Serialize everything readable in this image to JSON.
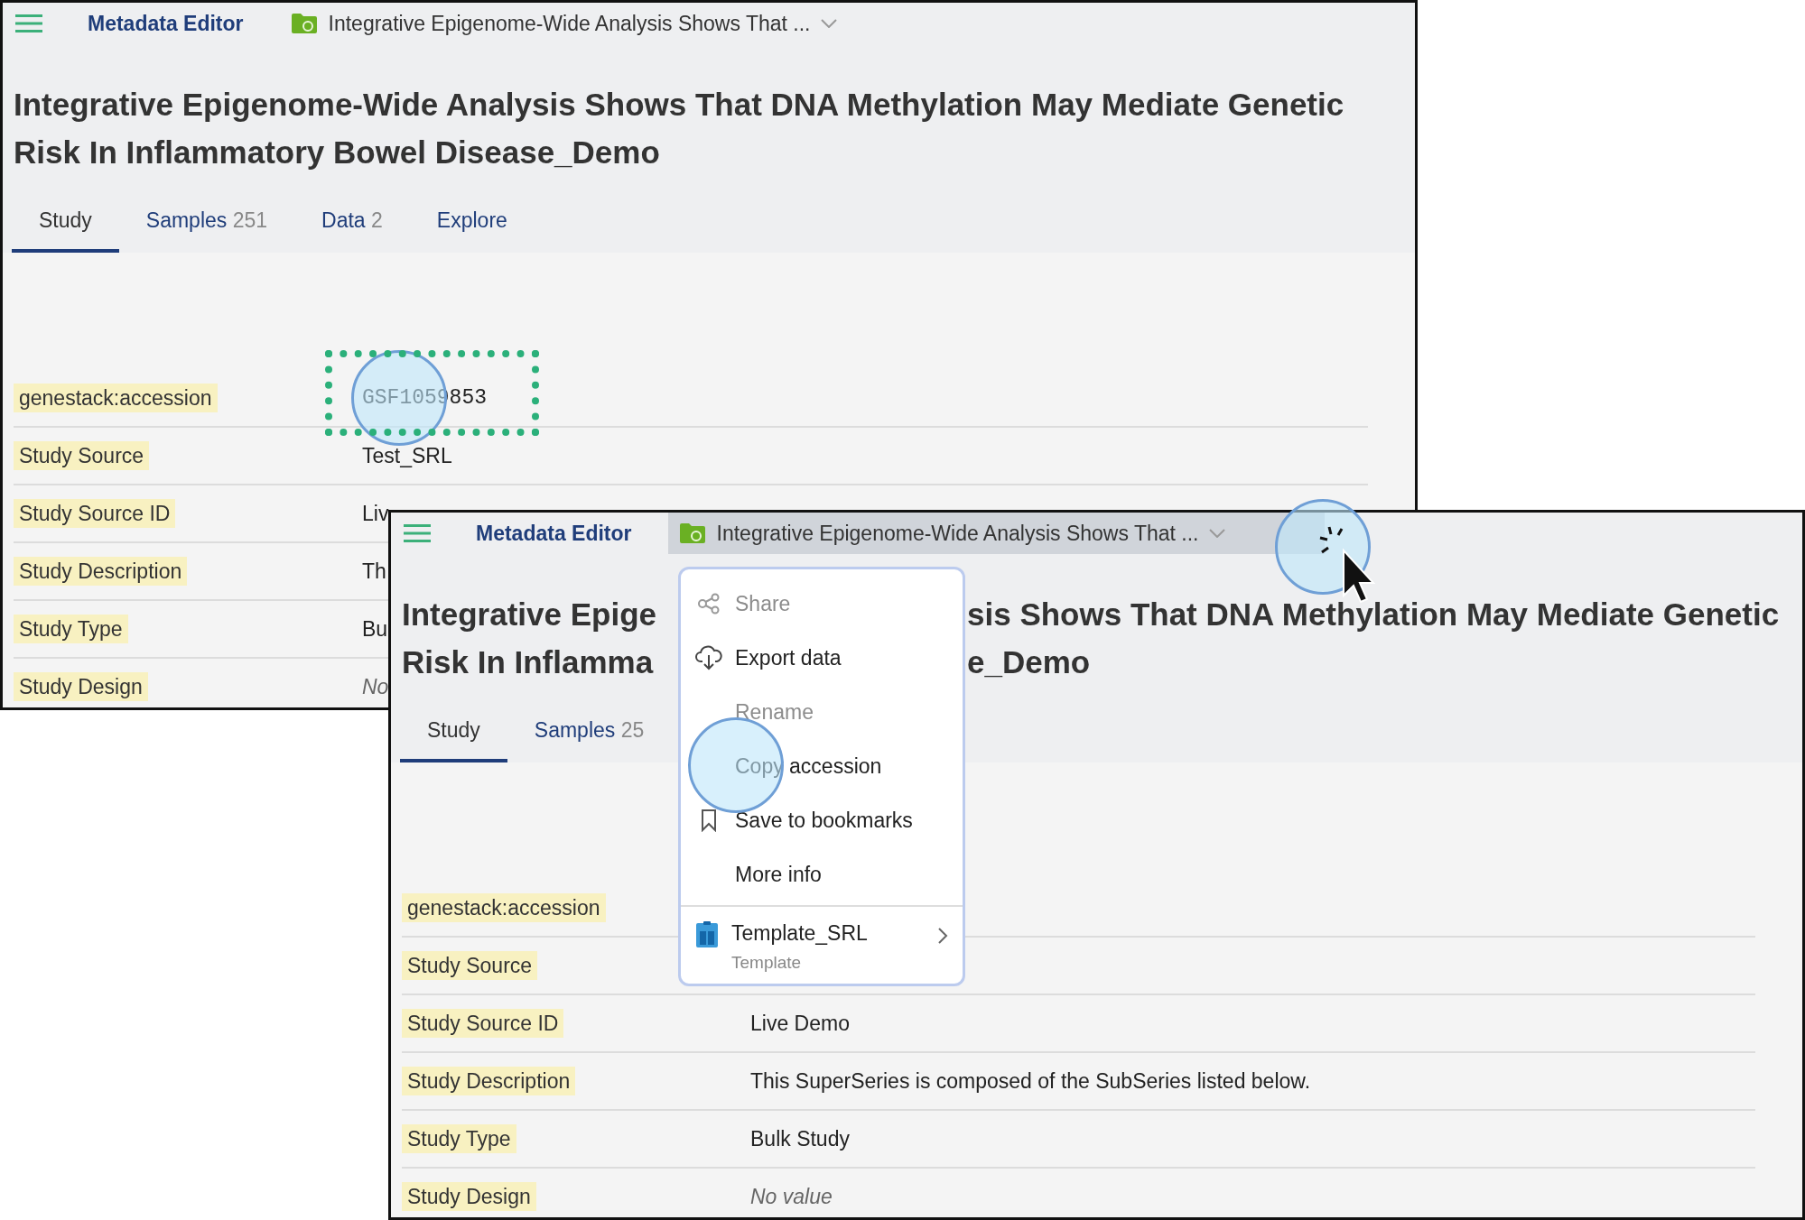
{
  "windows": [
    {
      "header": {
        "app_title": "Metadata Editor",
        "dataset_title": "Integrative Epigenome-Wide Analysis Shows That ...",
        "dropdown_open": false
      },
      "title": "Integrative Epigenome-Wide Analysis Shows That DNA Methylation May Mediate Genetic Risk In Inflammatory Bowel Disease_Demo",
      "tabs": [
        {
          "label": "Study",
          "selected": true
        },
        {
          "label": "Samples",
          "count": "251",
          "selected": false
        },
        {
          "label": "Data",
          "count": "2",
          "selected": false
        },
        {
          "label": "Explore",
          "selected": false
        }
      ],
      "rows": [
        {
          "label": "genestack:accession",
          "value": "GSF1059853",
          "kind": "mono"
        },
        {
          "label": "Study Source",
          "value": "Test_SRL",
          "kind": "text"
        },
        {
          "label": "Study Source ID",
          "value": "Liv",
          "kind": "text"
        },
        {
          "label": "Study Description",
          "value": "Th",
          "kind": "text"
        },
        {
          "label": "Study Type",
          "value": "Bu",
          "kind": "text"
        },
        {
          "label": "Study Design",
          "value": "No",
          "kind": "empty"
        }
      ]
    },
    {
      "header": {
        "app_title": "Metadata Editor",
        "dataset_title": "Integrative Epigenome-Wide Analysis Shows That ...",
        "dropdown_open": true
      },
      "title_parts": [
        [
          "Integrative Epige",
          "sis Shows That DNA Methylation May Mediate Genetic"
        ],
        [
          "Risk In Inflamma",
          "e_Demo"
        ]
      ],
      "tabs": [
        {
          "label": "Study",
          "selected": true
        },
        {
          "label": "Samples",
          "count": "25",
          "selected": false
        }
      ],
      "rows": [
        {
          "label": "genestack:accession"
        },
        {
          "label": "Study Source"
        },
        {
          "label": "Study Source ID",
          "value": "Live Demo",
          "kind": "text"
        },
        {
          "label": "Study Description",
          "value": "This SuperSeries is composed of the SubSeries listed below.",
          "kind": "text"
        },
        {
          "label": "Study Type",
          "value": "Bulk Study",
          "kind": "text"
        },
        {
          "label": "Study Design",
          "value": "No value",
          "kind": "empty"
        }
      ],
      "menu": {
        "items": [
          {
            "label": "Share",
            "kind": "share",
            "disabled": true
          },
          {
            "label": "Export data",
            "kind": "export",
            "disabled": false
          },
          {
            "label": "Rename",
            "kind": "plain",
            "disabled": true
          },
          {
            "label": "Copy accession",
            "kind": "plain",
            "disabled": false
          },
          {
            "label": "Save to bookmarks",
            "kind": "bookmark",
            "disabled": false
          },
          {
            "label": "More info",
            "kind": "plain",
            "disabled": false
          }
        ],
        "template": {
          "label": "Template_SRL",
          "subtitle": "Template"
        }
      }
    }
  ]
}
